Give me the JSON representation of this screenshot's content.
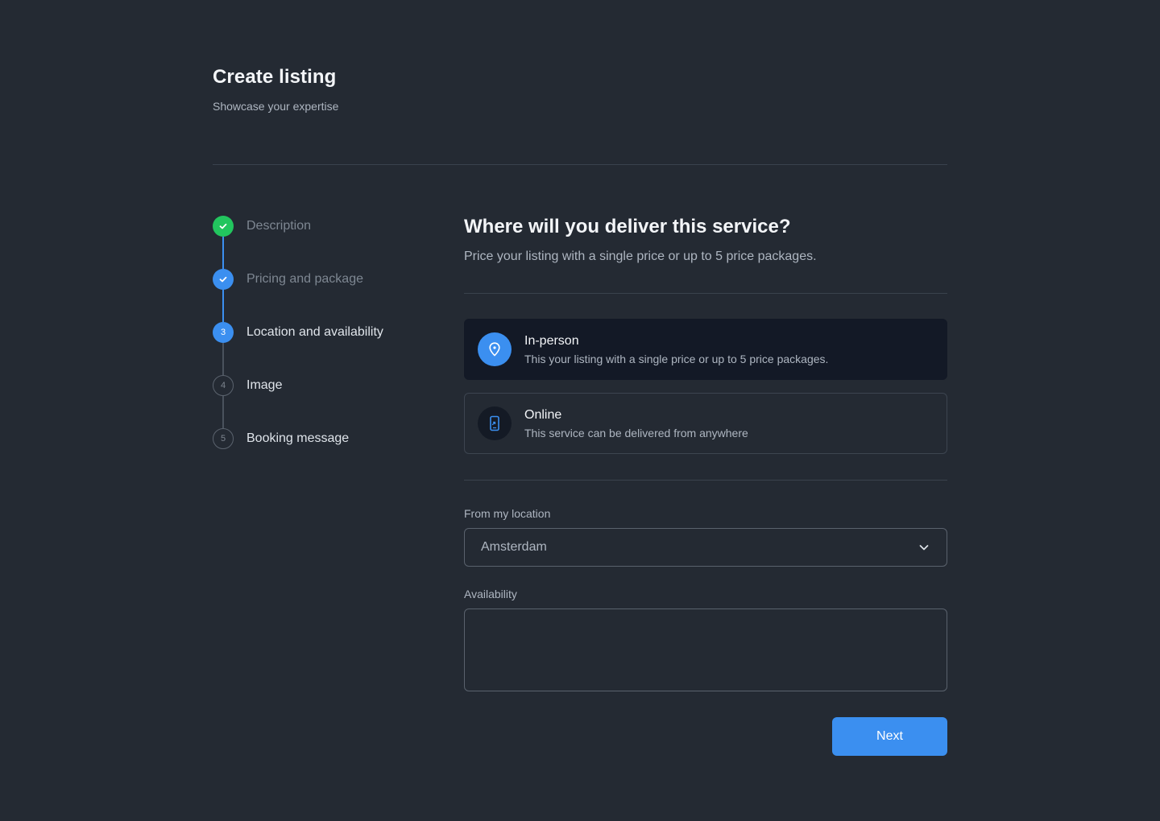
{
  "header": {
    "title": "Create listing",
    "subtitle": "Showcase your expertise"
  },
  "stepper": {
    "steps": [
      {
        "number": "1",
        "label": "Description",
        "status": "completed"
      },
      {
        "number": "2",
        "label": "Pricing and package",
        "status": "completed"
      },
      {
        "number": "3",
        "label": "Location and availability",
        "status": "current"
      },
      {
        "number": "4",
        "label": "Image",
        "status": "upcoming"
      },
      {
        "number": "5",
        "label": "Booking message",
        "status": "upcoming"
      }
    ]
  },
  "main": {
    "question": "Where will you deliver this service?",
    "description": "Price your listing with a single price or up to 5 price packages.",
    "options": [
      {
        "title": "In-person",
        "description": "This your listing with a single price or up to 5 price packages.",
        "selected": true,
        "icon": "location-pin-icon"
      },
      {
        "title": "Online",
        "description": "This service can be delivered from anywhere",
        "selected": false,
        "icon": "mobile-phone-icon"
      }
    ],
    "location": {
      "label": "From my location",
      "value": "Amsterdam"
    },
    "availability": {
      "label": "Availability",
      "value": ""
    },
    "next_label": "Next"
  },
  "colors": {
    "background": "#242a33",
    "accent": "#3b8ff0",
    "success": "#22c55e",
    "selected_card": "#131926"
  }
}
